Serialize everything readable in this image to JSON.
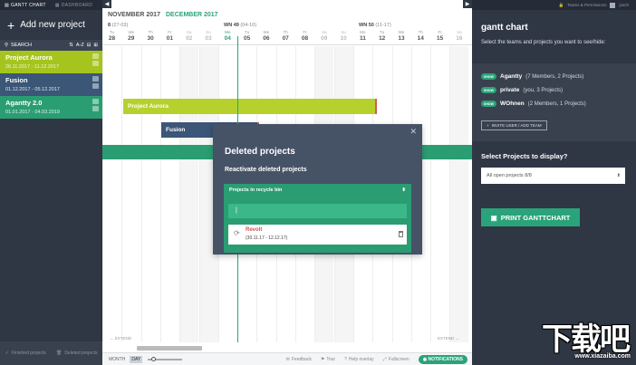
{
  "sidebar": {
    "tabs": [
      {
        "label": "GANTT CHART"
      },
      {
        "label": "DASHBOARD"
      }
    ],
    "add_project_label": "Add new project",
    "search_label": "SEARCH",
    "sort_label": "A-Z",
    "projects": [
      {
        "name": "Project Aurora",
        "dates": "26.11.2017 - 11.12.2017"
      },
      {
        "name": "Fusion",
        "dates": "01.12.2017 - 05.12.2017"
      },
      {
        "name": "Agantty 2.0",
        "dates": "01.01.2017 - 04.03.2019"
      }
    ],
    "bottom": {
      "finished": "Finished projects",
      "deleted": "Deleted projects"
    }
  },
  "timeline": {
    "months": {
      "first": "NOVEMBER 2017",
      "second": "DECEMBER 2017"
    },
    "weeks": [
      {
        "label": "8",
        "range": "(27-03)"
      },
      {
        "label": "WN 49",
        "range": "(04-10)"
      },
      {
        "label": "WN 50",
        "range": "(11-17)"
      }
    ],
    "days": [
      {
        "dow": "Tu",
        "n": "28"
      },
      {
        "dow": "We",
        "n": "29"
      },
      {
        "dow": "Th",
        "n": "30"
      },
      {
        "dow": "Fr",
        "n": "01"
      },
      {
        "dow": "Sa",
        "n": "02"
      },
      {
        "dow": "Su",
        "n": "03"
      },
      {
        "dow": "Mo",
        "n": "04"
      },
      {
        "dow": "Tu",
        "n": "05"
      },
      {
        "dow": "We",
        "n": "06"
      },
      {
        "dow": "Th",
        "n": "07"
      },
      {
        "dow": "Fr",
        "n": "08"
      },
      {
        "dow": "Sa",
        "n": "09"
      },
      {
        "dow": "Su",
        "n": "10"
      },
      {
        "dow": "Mo",
        "n": "11"
      },
      {
        "dow": "Tu",
        "n": "12"
      },
      {
        "dow": "We",
        "n": "13"
      },
      {
        "dow": "Th",
        "n": "14"
      },
      {
        "dow": "Fr",
        "n": "15"
      },
      {
        "dow": "Sa",
        "n": "16"
      }
    ],
    "bars": {
      "aurora": "Project Aurora",
      "fusion": "Fusion"
    },
    "extend": "EXTEND"
  },
  "toolbar": {
    "month": "MONTH",
    "day": "DAY",
    "feedback": "Feedback",
    "tour": "Tour",
    "help": "Help overlay",
    "fullscreen": "Fullscreen",
    "notifications": "NOTIFICATIONS"
  },
  "modal": {
    "title": "Deleted projects",
    "subtitle": "Reactivate deleted projects",
    "recycle_header": "Projects in recycle bin",
    "search_value": "|",
    "item_name": "Revolt",
    "item_dates": "(30.11.17 - 12.12.17)"
  },
  "right_panel": {
    "top_link": "Teams & Permissions",
    "user": "josch",
    "title": "gantt chart",
    "desc": "Select the teams and projects you want to see/hide:",
    "toggle_label": "SHOW",
    "teams": [
      {
        "name": "Agantty",
        "meta": "(7 Members, 2 Projects)"
      },
      {
        "name": "private",
        "meta": "(you, 3 Projects)"
      },
      {
        "name": "WOhnen",
        "meta": "(2 Members, 1 Projects)"
      }
    ],
    "invite": "INVITE USER / ADD TEAM",
    "select_label": "Select Projects to display?",
    "select_value": "All open projects 8/8",
    "print": "PRINT GANTTCHART"
  },
  "watermark": {
    "big": "下载吧",
    "url": "www.xiazaiba.com"
  }
}
